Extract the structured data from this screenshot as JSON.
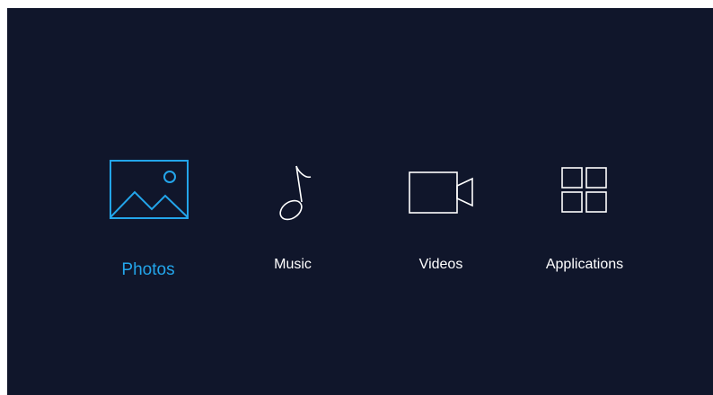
{
  "menu": {
    "selected_color": "#23a5ea",
    "normal_color": "#ffffff",
    "background_color": "#10162b",
    "items": [
      {
        "label": "Photos",
        "icon": "image-icon",
        "selected": true
      },
      {
        "label": "Music",
        "icon": "music-note-icon",
        "selected": false
      },
      {
        "label": "Videos",
        "icon": "video-camera-icon",
        "selected": false
      },
      {
        "label": "Applications",
        "icon": "apps-grid-icon",
        "selected": false
      }
    ]
  }
}
